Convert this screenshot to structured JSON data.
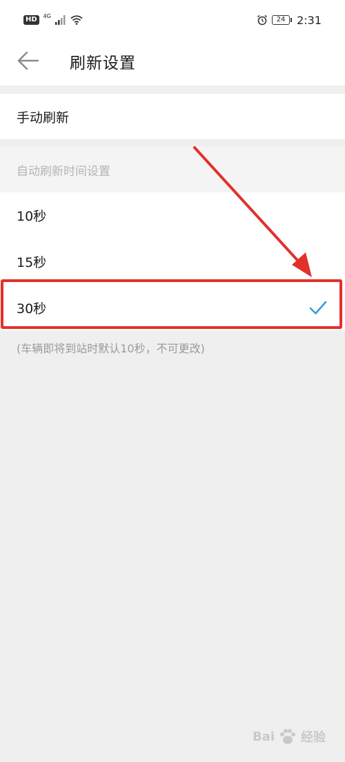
{
  "status_bar": {
    "hd": "HD",
    "network": "4G",
    "battery": "24",
    "time": "2:31"
  },
  "header": {
    "title": "刷新设置"
  },
  "manual_refresh": {
    "label": "手动刷新"
  },
  "auto_section": {
    "title": "自动刷新时间设置",
    "options": [
      {
        "label": "10秒",
        "selected": false
      },
      {
        "label": "15秒",
        "selected": false
      },
      {
        "label": "30秒",
        "selected": true
      }
    ],
    "note": "(车辆即将到站时默认10秒，不可更改)"
  },
  "watermark": {
    "text_a": "Bai",
    "text_b": "经验"
  },
  "colors": {
    "accent_check": "#3a9ad9",
    "annotation_red": "#e2302b"
  }
}
